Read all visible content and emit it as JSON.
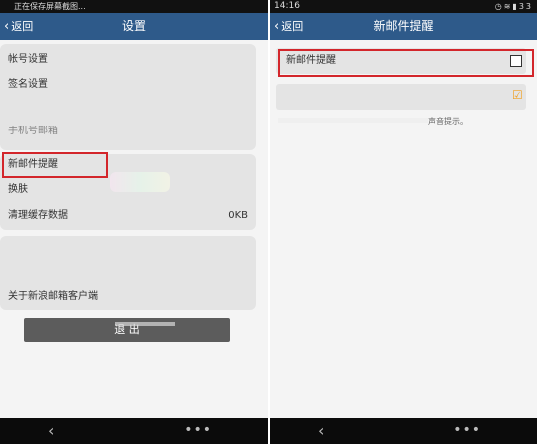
{
  "left": {
    "status": {
      "notice": "正在保存屏幕截图..."
    },
    "header": {
      "back_label": "返回",
      "title": "设置"
    },
    "settings": {
      "group1": [
        "帐号设置",
        "签名设置",
        "手机号邮箱"
      ],
      "group2": [
        {
          "label": "新邮件提醒",
          "value": ""
        },
        {
          "label": "换肤",
          "value": ""
        },
        {
          "label": "清理缓存数据",
          "value": "0KB"
        }
      ],
      "group3": [
        "关于新浪邮箱客户端"
      ]
    },
    "logout_label": "退 出"
  },
  "right": {
    "status": {
      "time": "14:16",
      "battery": "33"
    },
    "header": {
      "back_label": "返回",
      "title": "新邮件提醒"
    },
    "row1": {
      "label": "新邮件提醒",
      "checked": false
    },
    "row2": {
      "label": "",
      "checked": true
    },
    "hint_suffix": "声音提示。"
  },
  "colors": {
    "title_bar": "#2e5a8a",
    "highlight": "#d3262b",
    "check": "#f0a020"
  }
}
